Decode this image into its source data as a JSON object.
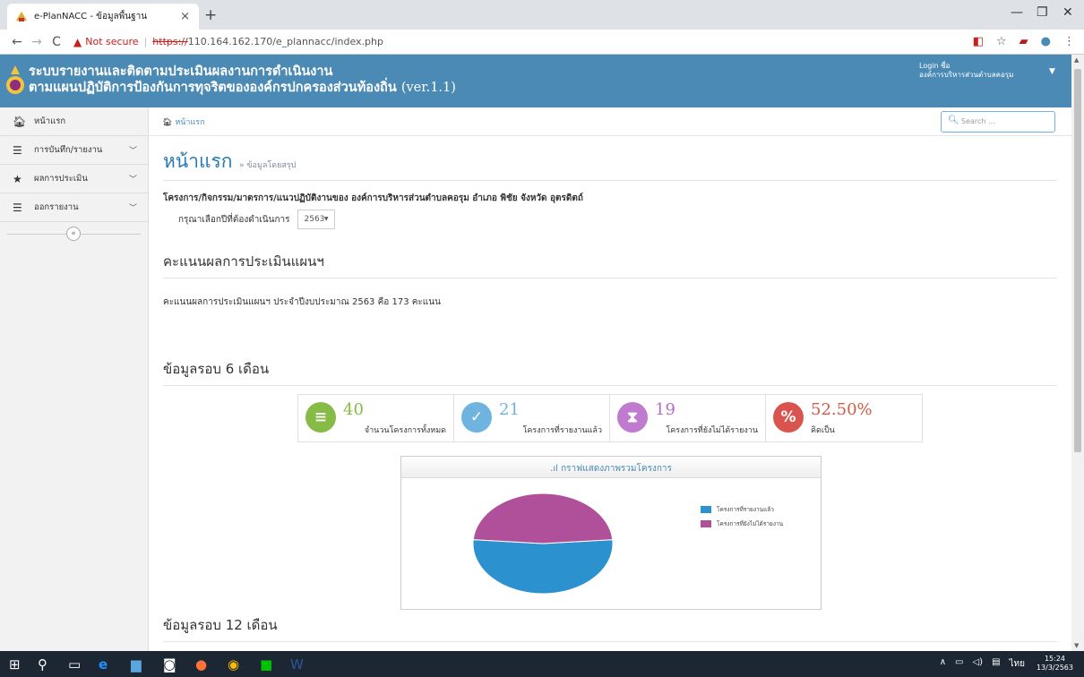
{
  "browser": {
    "tab_title": "e-PlanNACC - ข้อมูลพื้นฐาน",
    "tab_close": "×",
    "new_tab": "+",
    "not_secure": "Not secure",
    "url_scheme": "https://",
    "url_rest": "110.164.162.170/e_plannacc/index.php"
  },
  "app": {
    "title_line1": "ระบบรายงานและติดตามประเมินผลงานการดำเนินงาน",
    "title_line2": "ตามแผนปฏิบัติการป้องกันการทุจริตขององค์กรปกครองส่วนท้องถิ่น",
    "version": "(ver.1.1)",
    "login_label": "Login ชื่อ",
    "login_name": "องค์การบริหารส่วนตำบลคอรุม"
  },
  "sidebar": {
    "items": [
      {
        "label": "หน้าแรก",
        "icon": "home-icon"
      },
      {
        "label": "การบันทึก/รายงาน",
        "icon": "list-icon"
      },
      {
        "label": "ผลการประเมิน",
        "icon": "star-icon"
      },
      {
        "label": "ออกรายงาน",
        "icon": "list-icon"
      }
    ]
  },
  "breadcrumb": {
    "home": "หน้าแรก"
  },
  "search": {
    "placeholder": "Search ..."
  },
  "page": {
    "title": "หน้าแรก",
    "subtitle": "» ข้อมูลโดยสรุป",
    "org_line": "โครงการ/กิจกรรม/มาตรการ/แนวปฏิบัติงานของ องค์การบริหารส่วนตำบลคอรุม อำเภอ พิชัย จังหวัด อุตรดิตถ์",
    "year_label": "กรุณาเลือกปีที่ต้องดำเนินการ",
    "year_value": "2563",
    "score_heading": "คะแนนผลการประเมินแผนฯ",
    "score_text": "คะแนนผลการประเมินแผนฯ ประจำปีงบประมาณ 2563 คือ 173 คะแนน",
    "six_month_heading": "ข้อมูลรอบ 6 เดือน",
    "twelve_month_heading": "ข้อมูลรอบ 12 เดือน"
  },
  "stats": [
    {
      "value": "40",
      "label": "จำนวนโครงการทั้งหมด",
      "color": "#86bb45"
    },
    {
      "value": "21",
      "label": "โครงการที่รายงานแล้ว",
      "color": "#6fb3e0"
    },
    {
      "value": "19",
      "label": "โครงการที่ยังไม่ได้รายงาน",
      "color": "#c07ad0"
    },
    {
      "value": "52.50%",
      "label": "คิดเป็น",
      "color": "#d9534f"
    }
  ],
  "chart_title": "กราฟแสดงภาพรวมโครงการ",
  "chart_data": {
    "type": "pie",
    "title": "กราฟแสดงภาพรวมโครงการ",
    "categories": [
      "โครงการที่รายงานแล้ว",
      "โครงการที่ยังไม่ได้รายงาน"
    ],
    "values": [
      21,
      19
    ],
    "colors": [
      "#2b91cf",
      "#b0509a"
    ],
    "legend": "right"
  },
  "taskbar": {
    "time": "15:24",
    "date": "13/3/2563",
    "lang": "ไทย"
  }
}
